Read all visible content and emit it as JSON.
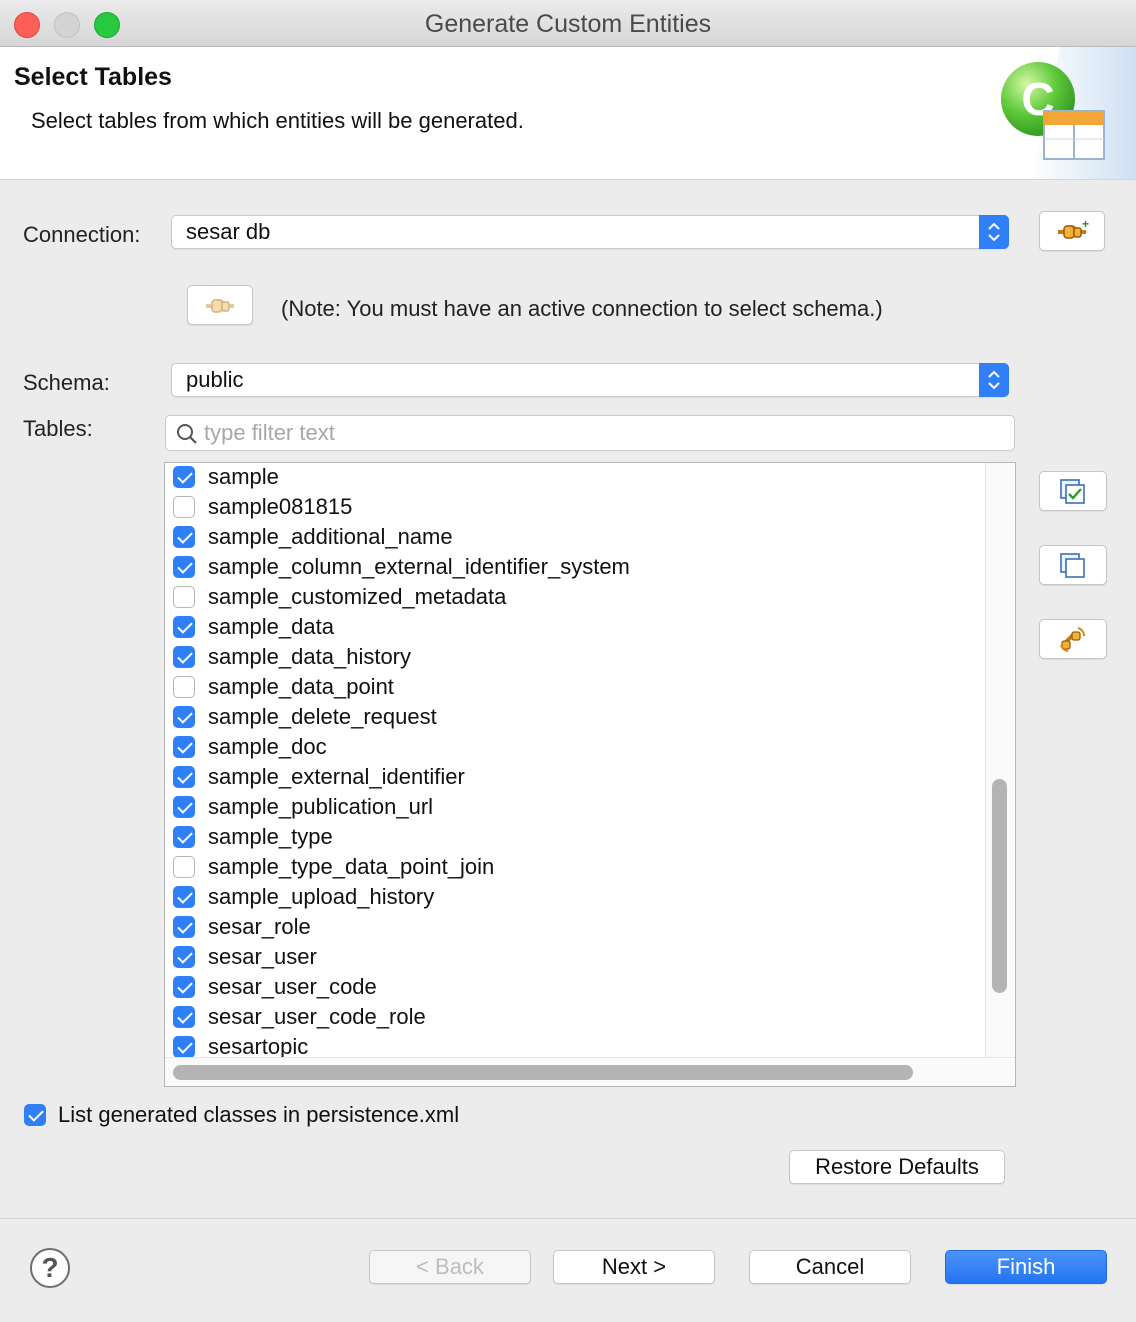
{
  "window": {
    "title": "Generate Custom Entities"
  },
  "header": {
    "title": "Select Tables",
    "description": "Select tables from which entities will be generated."
  },
  "connection": {
    "label": "Connection:",
    "value": "sesar db"
  },
  "note": "(Note: You must have an active connection to select schema.)",
  "schema": {
    "label": "Schema:",
    "value": "public"
  },
  "tables": {
    "label": "Tables:",
    "filter_placeholder": "type filter text",
    "items": [
      {
        "name": "sample",
        "checked": true
      },
      {
        "name": "sample081815",
        "checked": false
      },
      {
        "name": "sample_additional_name",
        "checked": true
      },
      {
        "name": "sample_column_external_identifier_system",
        "checked": true
      },
      {
        "name": "sample_customized_metadata",
        "checked": false
      },
      {
        "name": "sample_data",
        "checked": true
      },
      {
        "name": "sample_data_history",
        "checked": true
      },
      {
        "name": "sample_data_point",
        "checked": false
      },
      {
        "name": "sample_delete_request",
        "checked": true
      },
      {
        "name": "sample_doc",
        "checked": true
      },
      {
        "name": "sample_external_identifier",
        "checked": true
      },
      {
        "name": "sample_publication_url",
        "checked": true
      },
      {
        "name": "sample_type",
        "checked": true
      },
      {
        "name": "sample_type_data_point_join",
        "checked": false
      },
      {
        "name": "sample_upload_history",
        "checked": true
      },
      {
        "name": "sesar_role",
        "checked": true
      },
      {
        "name": "sesar_user",
        "checked": true
      },
      {
        "name": "sesar_user_code",
        "checked": true
      },
      {
        "name": "sesar_user_code_role",
        "checked": true
      },
      {
        "name": "sesartopic",
        "checked": true
      }
    ]
  },
  "persistence": {
    "label": "List generated classes in persistence.xml",
    "checked": true
  },
  "buttons": {
    "restore_defaults": "Restore Defaults",
    "back": "< Back",
    "next": "Next >",
    "cancel": "Cancel",
    "finish": "Finish",
    "help": "?"
  },
  "colors": {
    "accent": "#2f7ff6",
    "finish": "#2474f5"
  }
}
